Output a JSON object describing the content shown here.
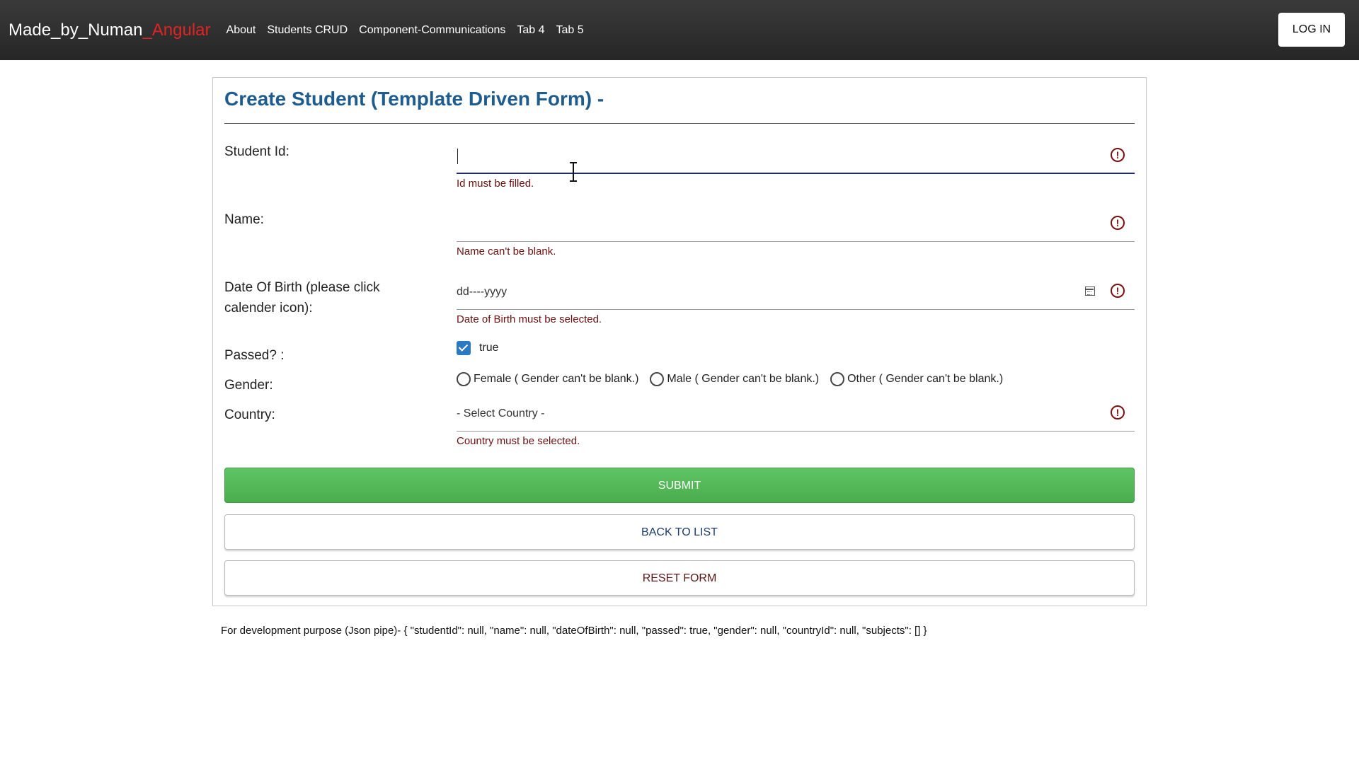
{
  "navbar": {
    "brand_main": "Made_by_Numan",
    "brand_accent": "_Angular",
    "links": [
      "About",
      "Students CRUD",
      "Component-Communications",
      "Tab 4",
      "Tab 5"
    ],
    "login_label": "LOG IN"
  },
  "form": {
    "title": "Create Student (Template Driven Form) -",
    "student_id": {
      "label": "Student Id:",
      "value": "",
      "error": "Id must be filled."
    },
    "name": {
      "label": "Name:",
      "value": "",
      "error": "Name can't be blank."
    },
    "dob": {
      "label_line1": "Date Of Birth (please click",
      "label_line2": "calender icon):",
      "placeholder": "dd----yyyy",
      "error": "Date of Birth must be selected."
    },
    "passed": {
      "label": "Passed? :",
      "checked": true,
      "option_label": "true"
    },
    "gender": {
      "label": "Gender:",
      "options": [
        "Female ( Gender can't be blank.)",
        "Male ( Gender can't be blank.)",
        "Other ( Gender can't be blank.)"
      ]
    },
    "country": {
      "label": "Country:",
      "selected": "- Select Country -",
      "error": "Country must be selected."
    },
    "buttons": {
      "submit": "SUBMIT",
      "back": "BACK TO LIST",
      "reset": "RESET FORM"
    }
  },
  "dev_note": "For development purpose (Json pipe)- { \"studentId\": null, \"name\": null, \"dateOfBirth\": null, \"passed\": true, \"gender\": null, \"countryId\": null, \"subjects\": [] }",
  "icons": {
    "error": "exclamation-circle-icon",
    "calendar": "calendar-icon"
  },
  "colors": {
    "title": "#1e5c8e",
    "brand_accent": "#e02424",
    "submit": "#4aad4e",
    "error": "#6b0f0f"
  }
}
